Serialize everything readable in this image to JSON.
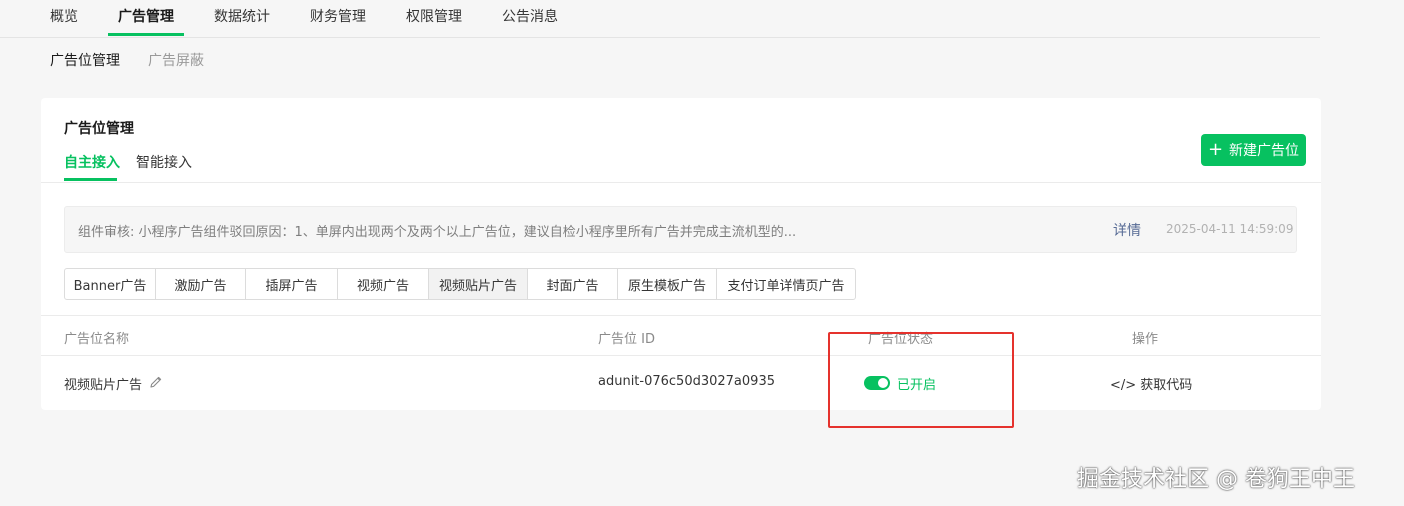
{
  "top_nav": {
    "items": [
      "概览",
      "广告管理",
      "数据统计",
      "财务管理",
      "权限管理",
      "公告消息"
    ],
    "active_index": 1
  },
  "sub_nav": {
    "items": [
      "广告位管理",
      "广告屏蔽"
    ],
    "active_index": 0
  },
  "card": {
    "title": "广告位管理",
    "tabs": [
      "自主接入",
      "智能接入"
    ],
    "active_tab": 0,
    "new_button_label": "新建广告位",
    "notice": {
      "text": "组件审核: 小程序广告组件驳回原因：1、单屏内出现两个及两个以上广告位，建议自检小程序里所有广告并完成主流机型的...",
      "detail_link": "详情",
      "time": "2025-04-11 14:59:09"
    },
    "ad_types": [
      "Banner广告",
      "激励广告",
      "插屏广告",
      "视频广告",
      "视频贴片广告",
      "封面广告",
      "原生模板广告",
      "支付订单详情页广告"
    ],
    "selected_ad_type": 4,
    "table": {
      "headers": [
        "广告位名称",
        "广告位 ID",
        "广告位状态",
        "操作"
      ],
      "rows": [
        {
          "name": "视频贴片广告",
          "id": "adunit-076c50d3027a0935",
          "status": "已开启",
          "status_on": true,
          "action": "</> 获取代码"
        }
      ]
    }
  },
  "watermark": "掘金技术社区 @ 卷狗王中王",
  "colors": {
    "accent": "#07c160",
    "highlight_box": "#e5322d",
    "link": "#576b95"
  }
}
